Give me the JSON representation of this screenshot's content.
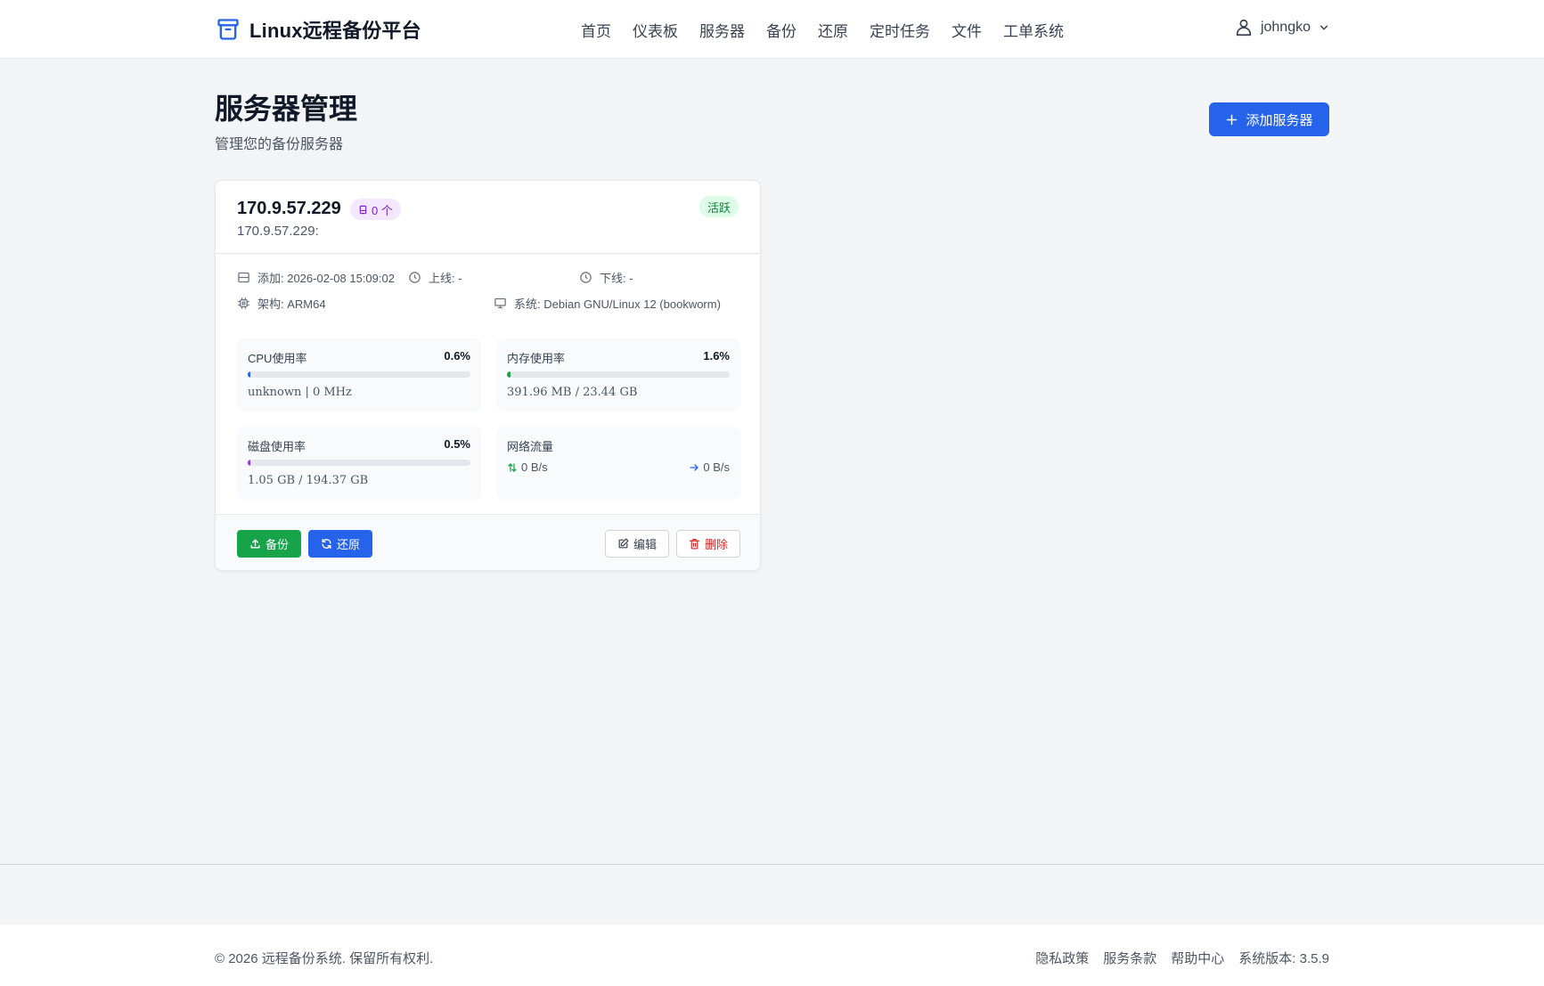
{
  "header": {
    "brand": "Linux远程备份平台",
    "nav": [
      "首页",
      "仪表板",
      "服务器",
      "备份",
      "还原",
      "定时任务",
      "文件",
      "工单系统"
    ],
    "username": "johngko"
  },
  "page": {
    "title": "服务器管理",
    "subtitle": "管理您的备份服务器",
    "add_button": "添加服务器"
  },
  "server": {
    "host": "170.9.57.229",
    "badge": "0 个",
    "host_sub": "170.9.57.229:",
    "status": "活跃",
    "added": "添加: 2026-02-08 15:09:02",
    "online": "上线: -",
    "offline": "下线: -",
    "arch": "架构: ARM64",
    "os": "系统: Debian GNU/Linux 12 (bookworm)",
    "cpu": {
      "label": "CPU使用率",
      "value": "0.6%",
      "percent": 0.6,
      "sub": "unknown | 0 MHz",
      "color": "#2563eb"
    },
    "memory": {
      "label": "内存使用率",
      "value": "1.6%",
      "percent": 1.6,
      "sub": "391.96 MB / 23.44 GB",
      "color": "#16a34a"
    },
    "disk": {
      "label": "磁盘使用率",
      "value": "0.5%",
      "percent": 0.5,
      "sub": "1.05 GB / 194.37 GB",
      "color": "#9333ea"
    },
    "network": {
      "label": "网络流量",
      "up": "0 B/s",
      "down": "0 B/s"
    },
    "actions": {
      "backup": "备份",
      "restore": "还原",
      "edit": "编辑",
      "delete": "删除"
    }
  },
  "footer": {
    "copyright": "© 2026 远程备份系统. 保留所有权利.",
    "links": [
      "隐私政策",
      "服务条款",
      "帮助中心",
      "系统版本: 3.5.9"
    ]
  },
  "colors": {
    "primary": "#2563eb",
    "success": "#16a34a",
    "danger": "#dc2626"
  }
}
